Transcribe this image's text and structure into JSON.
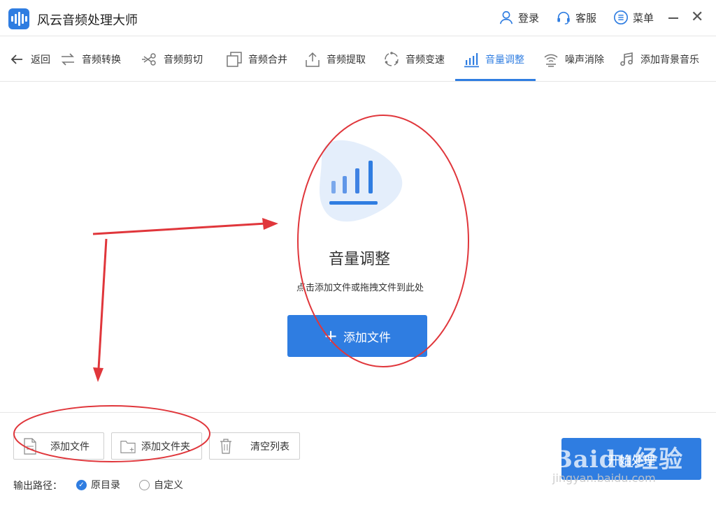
{
  "app": {
    "title": "风云音频处理大师",
    "accent_color": "#2f7de1",
    "annotation_color": "#e0363b"
  },
  "titlebar": {
    "login": "登录",
    "service": "客服",
    "menu": "菜单"
  },
  "nav": {
    "items": [
      {
        "label": "返回",
        "icon": "back-arrow-icon"
      },
      {
        "label": "音频转换",
        "icon": "convert-icon"
      },
      {
        "label": "音频剪切",
        "icon": "scissors-icon"
      },
      {
        "label": "音频合并",
        "icon": "merge-icon"
      },
      {
        "label": "音频提取",
        "icon": "extract-icon"
      },
      {
        "label": "音频变速",
        "icon": "speed-icon"
      },
      {
        "label": "音量调整",
        "icon": "volume-bars-icon",
        "active": true
      },
      {
        "label": "噪声消除",
        "icon": "noise-icon"
      },
      {
        "label": "添加背景音乐",
        "icon": "music-note-icon"
      }
    ]
  },
  "main": {
    "title": "音量调整",
    "hint": "点击添加文件或拖拽文件到此处",
    "add_file_label": "添加文件"
  },
  "bottom": {
    "add_file": "添加文件",
    "add_folder": "添加文件夹",
    "clear_list": "清空列表",
    "output_label": "输出路径：",
    "radio_original": "原目录",
    "radio_custom": "自定义",
    "start_label": "开始处理"
  },
  "watermark": {
    "text": "Baidu经验",
    "sub": "jingyan.baidu.com"
  }
}
